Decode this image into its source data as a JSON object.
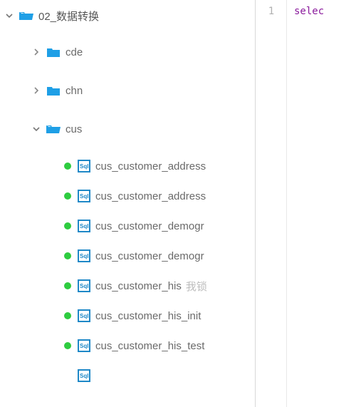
{
  "tree": {
    "root": {
      "label": "02_数据转换",
      "expanded": true
    },
    "folders": [
      {
        "label": "cde",
        "expanded": false
      },
      {
        "label": "chn",
        "expanded": false
      },
      {
        "label": "cus",
        "expanded": true
      }
    ],
    "cus_files": [
      {
        "label": "cus_customer_address",
        "extra": ""
      },
      {
        "label": "cus_customer_address",
        "extra": ""
      },
      {
        "label": "cus_customer_demogr",
        "extra": ""
      },
      {
        "label": "cus_customer_demogr",
        "extra": ""
      },
      {
        "label": "cus_customer_his",
        "extra": "我锁"
      },
      {
        "label": "cus_customer_his_init",
        "extra": ""
      },
      {
        "label": "cus_customer_his_test",
        "extra": ""
      }
    ],
    "partial_icon": true
  },
  "editor": {
    "line_number": "1",
    "code": "selec"
  }
}
